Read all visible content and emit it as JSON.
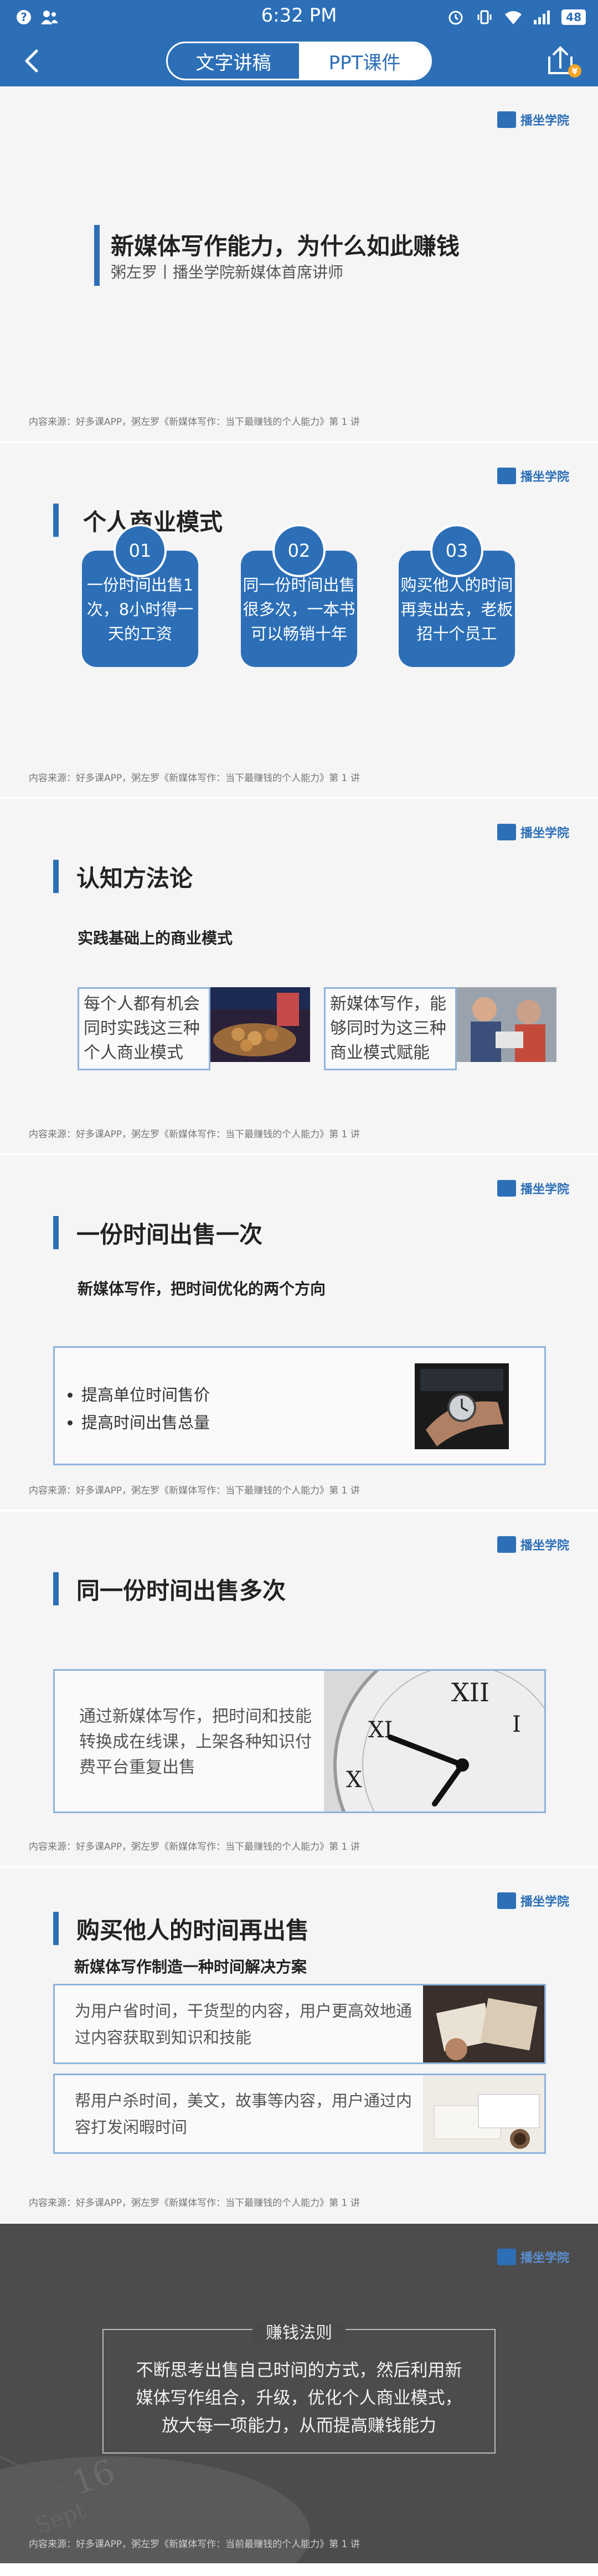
{
  "status_bar": {
    "time": "6:32 PM",
    "battery": "48"
  },
  "title_bar": {
    "tabs": [
      {
        "label": "文字讲稿"
      },
      {
        "label": "PPT课件"
      }
    ],
    "active_tab": "PPT课件"
  },
  "logo_text": "播坐学院",
  "source_text": "内容来源：好多课APP，粥左罗《新媒体写作：当下最赚钱的个人能力》第 1 讲",
  "colors": {
    "accent": "#2c6fb7",
    "border": "#8eb2dc",
    "slide_bg": "#f5f5f5"
  },
  "slides": [
    {
      "title": "新媒体写作能力，为什么如此赚钱",
      "subtitle": "粥左罗丨播坐学院新媒体首席讲师"
    },
    {
      "heading": "个人商业模式",
      "cards": [
        {
          "num": "01",
          "text": "一份时间出售1次，8小时得一天的工资"
        },
        {
          "num": "02",
          "text": "同一份时间出售很多次，一本书可以畅销十年"
        },
        {
          "num": "03",
          "text": "购买他人的时间再卖出去，老板招十个员工"
        }
      ]
    },
    {
      "heading": "认知方法论",
      "subheading": "实践基础上的商业模式",
      "boxes": [
        {
          "text": "每个人都有机会同时实践这三种个人商业模式"
        },
        {
          "text": "新媒体写作，能够同时为这三种商业模式赋能"
        }
      ]
    },
    {
      "heading": "一份时间出售一次",
      "subheading": "新媒体写作，把时间优化的两个方向",
      "bullets": [
        "提高单位时间售价",
        "提高时间出售总量"
      ]
    },
    {
      "heading": "同一份时间出售多次",
      "body": "通过新媒体写作，把时间和技能转换成在线课，上架各种知识付费平台重复出售"
    },
    {
      "heading": "购买他人的时间再出售",
      "subheading": "新媒体写作制造一种时间解决方案",
      "rows": [
        {
          "text": "为用户省时间，干货型的内容，用户更高效地通过内容获取到知识和技能"
        },
        {
          "text": "帮用户杀时间，美文，故事等内容，用户通过内容打发闲暇时间"
        }
      ]
    },
    {
      "rule_title": "赚钱法则",
      "rule_body": "不断思考出售自己时间的方式，然后利用新媒体写作组合，升级，优化个人商业模式，放大每一项能力，从而提高赚钱能力",
      "source_text": "内容来源：好多课APP，粥左罗《新媒体写作：当前最赚钱的个人能力》第 1 讲"
    }
  ]
}
